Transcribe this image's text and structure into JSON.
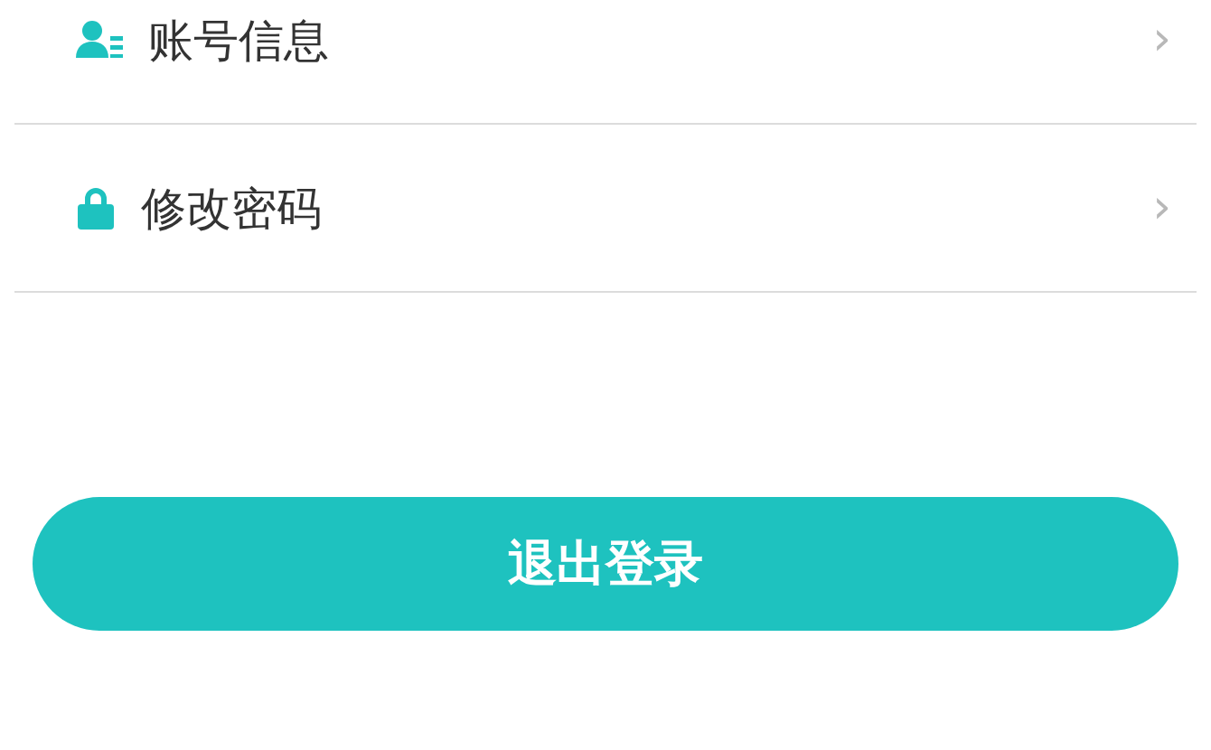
{
  "menu_items": [
    {
      "kind": "account",
      "label": "账号信息",
      "chevron": "›"
    },
    {
      "kind": "password",
      "label": "修改密码",
      "chevron": "›"
    }
  ],
  "logout_button": {
    "label": "退出登录"
  }
}
